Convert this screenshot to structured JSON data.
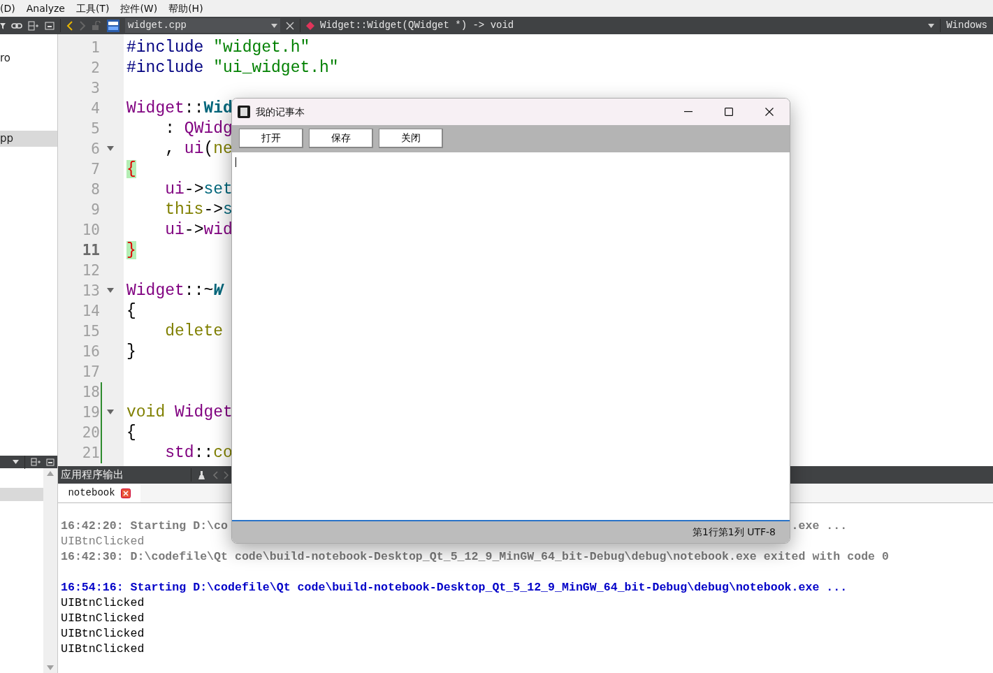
{
  "menu_bar": [
    "(D)",
    "Analyze",
    "工具(T)",
    "控件(W)",
    "帮助(H)"
  ],
  "toolbar": {
    "file": "widget.cpp",
    "symbol": "Widget::Widget(QWidget *) -> void",
    "right_label": "Windows"
  },
  "project_tree": {
    "items": [
      {
        "text": "ro",
        "selected": false
      },
      {
        "text": "pp",
        "selected": true
      }
    ]
  },
  "editor": {
    "lines": [
      {
        "number": "1",
        "current": false,
        "foldable": false,
        "changed": false,
        "segments": [
          {
            "text": "#include ",
            "kind": "preproc"
          },
          {
            "text": "\"widget.h\"",
            "kind": "string"
          }
        ]
      },
      {
        "number": "2",
        "current": false,
        "foldable": false,
        "changed": false,
        "segments": [
          {
            "text": "#include ",
            "kind": "preproc"
          },
          {
            "text": "\"ui_widget.h\"",
            "kind": "string"
          }
        ]
      },
      {
        "number": "3",
        "current": false,
        "foldable": false,
        "changed": false
      },
      {
        "number": "4",
        "current": false,
        "foldable": false,
        "changed": false,
        "segments": [
          {
            "text": "Widget",
            "kind": "type"
          },
          {
            "text": "::",
            "kind": "plain"
          },
          {
            "text": "Wid",
            "kind": "decl"
          }
        ]
      },
      {
        "number": "5",
        "current": false,
        "foldable": false,
        "changed": false,
        "segments": [
          {
            "text": "    : ",
            "kind": "plain"
          },
          {
            "text": "QWidg",
            "kind": "type"
          }
        ]
      },
      {
        "number": "6",
        "current": false,
        "foldable": true,
        "changed": false,
        "segments": [
          {
            "text": "    , ",
            "kind": "plain"
          },
          {
            "text": "ui",
            "kind": "type"
          },
          {
            "text": "(",
            "kind": "plain"
          },
          {
            "text": "ne",
            "kind": "keyword"
          }
        ]
      },
      {
        "number": "7",
        "current": false,
        "foldable": false,
        "changed": false,
        "segments": [
          {
            "text": "{",
            "kind": "brace-match"
          }
        ]
      },
      {
        "number": "8",
        "current": false,
        "foldable": false,
        "changed": false,
        "segments": [
          {
            "text": "    ui",
            "kind": "type"
          },
          {
            "text": "->",
            "kind": "plain"
          },
          {
            "text": "set",
            "kind": "func"
          }
        ]
      },
      {
        "number": "9",
        "current": false,
        "foldable": false,
        "changed": false,
        "segments": [
          {
            "text": "    this",
            "kind": "keyword"
          },
          {
            "text": "->",
            "kind": "plain"
          },
          {
            "text": "s",
            "kind": "func"
          }
        ]
      },
      {
        "number": "10",
        "current": false,
        "foldable": false,
        "changed": false,
        "segments": [
          {
            "text": "    ui",
            "kind": "type"
          },
          {
            "text": "->",
            "kind": "plain"
          },
          {
            "text": "wid",
            "kind": "type"
          }
        ]
      },
      {
        "number": "11",
        "current": true,
        "foldable": false,
        "changed": false,
        "segments": [
          {
            "text": "}",
            "kind": "brace-match"
          }
        ]
      },
      {
        "number": "12",
        "current": false,
        "foldable": false,
        "changed": false
      },
      {
        "number": "13",
        "current": false,
        "foldable": true,
        "changed": false,
        "segments": [
          {
            "text": "Widget",
            "kind": "type"
          },
          {
            "text": "::~",
            "kind": "plain"
          },
          {
            "text": "W",
            "kind": "decl-italic"
          }
        ]
      },
      {
        "number": "14",
        "current": false,
        "foldable": false,
        "changed": false,
        "segments": [
          {
            "text": "{",
            "kind": "plain"
          }
        ]
      },
      {
        "number": "15",
        "current": false,
        "foldable": false,
        "changed": false,
        "segments": [
          {
            "text": "    delete",
            "kind": "keyword"
          }
        ]
      },
      {
        "number": "16",
        "current": false,
        "foldable": false,
        "changed": false,
        "segments": [
          {
            "text": "}",
            "kind": "plain"
          }
        ]
      },
      {
        "number": "17",
        "current": false,
        "foldable": false,
        "changed": false
      },
      {
        "number": "18",
        "current": false,
        "foldable": false,
        "changed": true
      },
      {
        "number": "19",
        "current": false,
        "foldable": true,
        "changed": true,
        "segments": [
          {
            "text": "void ",
            "kind": "keyword"
          },
          {
            "text": "Widget",
            "kind": "type"
          }
        ]
      },
      {
        "number": "20",
        "current": false,
        "foldable": false,
        "changed": true,
        "segments": [
          {
            "text": "{",
            "kind": "plain"
          }
        ]
      },
      {
        "number": "21",
        "current": false,
        "foldable": false,
        "changed": true,
        "segments": [
          {
            "text": "    std",
            "kind": "type"
          },
          {
            "text": "::",
            "kind": "plain"
          },
          {
            "text": "co",
            "kind": "keyword"
          }
        ]
      }
    ]
  },
  "output_pane": {
    "title": "应用程序输出",
    "tabs": [
      {
        "label": "notebook",
        "selected": true
      }
    ],
    "lines": [
      {
        "kind": "status",
        "faded": true,
        "gap_before": false,
        "text": "16:42:20: Starting D:\\co",
        "tail": ".exe ..."
      },
      {
        "kind": "stdout",
        "faded": true,
        "gap_before": false,
        "text": "UIBtnClicked"
      },
      {
        "kind": "status",
        "faded": true,
        "gap_before": false,
        "text": "16:42:30: D:\\codefile\\Qt code\\build-notebook-Desktop_Qt_5_12_9_MinGW_64_bit-Debug\\debug\\notebook.exe exited with code 0"
      },
      {
        "kind": "status",
        "faded": false,
        "gap_before": true,
        "text": "16:54:16: Starting D:\\codefile\\Qt code\\build-notebook-Desktop_Qt_5_12_9_MinGW_64_bit-Debug\\debug\\notebook.exe ..."
      },
      {
        "kind": "stdout",
        "faded": false,
        "gap_before": false,
        "text": "UIBtnClicked"
      },
      {
        "kind": "stdout",
        "faded": false,
        "gap_before": false,
        "text": "UIBtnClicked"
      },
      {
        "kind": "stdout",
        "faded": false,
        "gap_before": false,
        "text": "UIBtnClicked"
      },
      {
        "kind": "stdout",
        "faded": false,
        "gap_before": false,
        "text": "UIBtnClicked"
      }
    ]
  },
  "app_window": {
    "title": "我的记事本",
    "buttons": [
      "打开",
      "保存",
      "关闭"
    ],
    "status": "第1行第1列 UTF-8"
  }
}
